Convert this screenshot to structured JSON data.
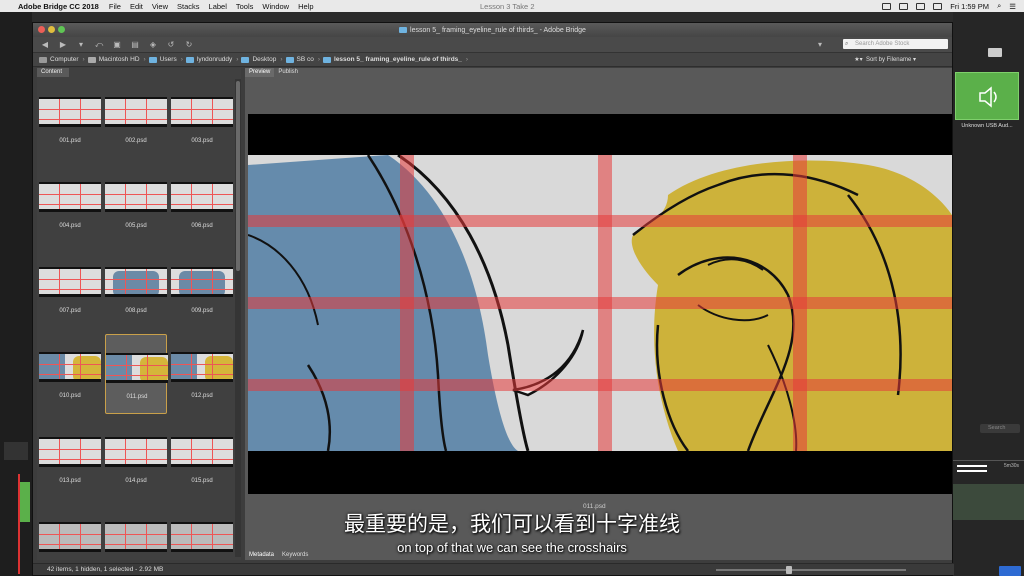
{
  "menubar": {
    "app_name": "Adobe Bridge CC 2018",
    "items": [
      "File",
      "Edit",
      "View",
      "Stacks",
      "Label",
      "Tools",
      "Window",
      "Help"
    ],
    "center_title": "Lesson 3 Take 2",
    "clock": "Fri 1:59 PM"
  },
  "window": {
    "title": "lesson 5_ framing_eyeline_rule of thirds_ - Adobe Bridge",
    "search_placeholder": "Search Adobe Stock"
  },
  "pathbar": {
    "crumbs": [
      "Computer",
      "Macintosh HD",
      "Users",
      "lyndonruddy",
      "Desktop",
      "SB co",
      "lesson 5_ framing_eyeline_rule of thirds_"
    ],
    "sort_label": "Sort by Filename"
  },
  "content_panel": {
    "tab": "Content",
    "thumbnails": [
      "001.psd",
      "002.psd",
      "003.psd",
      "004.psd",
      "005.psd",
      "006.psd",
      "007.psd",
      "008.psd",
      "009.psd",
      "010.psd",
      "011.psd",
      "012.psd",
      "013.psd",
      "014.psd",
      "015.psd",
      "",
      "",
      ""
    ],
    "selected": "011.psd"
  },
  "preview_panel": {
    "tabs": [
      "Preview",
      "Publish"
    ],
    "filename": "011.psd"
  },
  "bottom_tabs": [
    "Metadata",
    "Keywords"
  ],
  "status": {
    "text": "42 items, 1 hidden, 1 selected - 2.92 MB"
  },
  "side_app": {
    "audio_label": "Unknown USB Aud...",
    "search": "Search",
    "time": "5m30s"
  },
  "subtitles": {
    "chinese": "最重要的是，我们可以看到十字准线",
    "english": "on top of that we can see the crosshairs"
  },
  "colors": {
    "accent_green": "#5bb04a",
    "selection_gold": "#c9a04a",
    "grid_red": "#e55"
  }
}
